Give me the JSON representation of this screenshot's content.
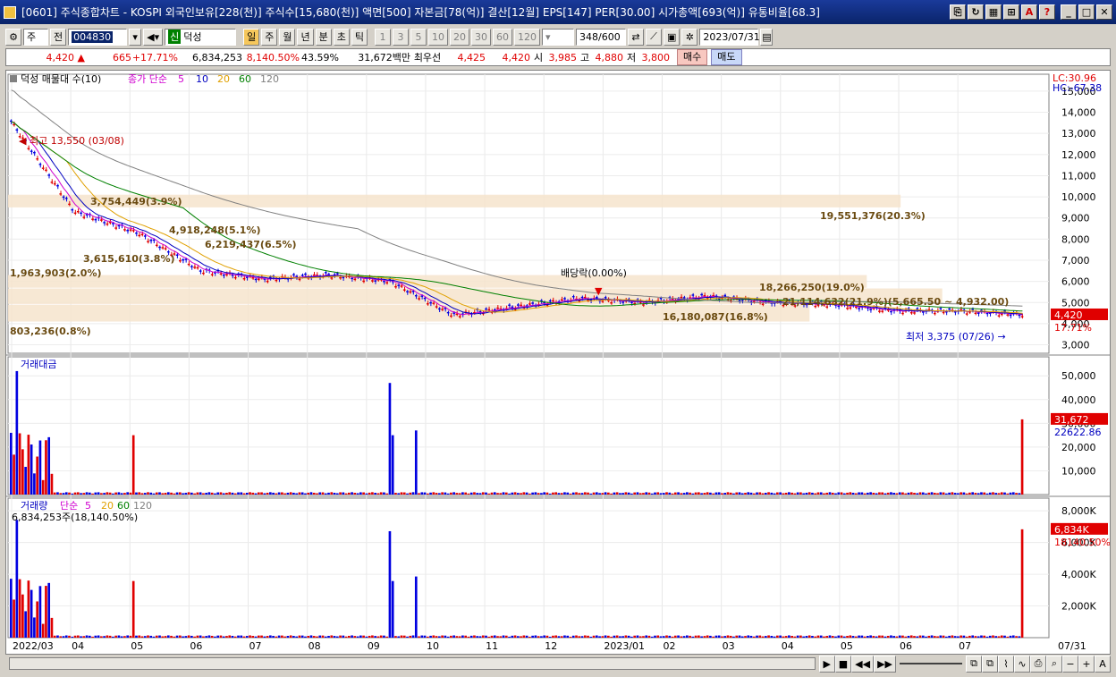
{
  "window": {
    "title": "[0601] 주식종합차트 - KOSPI 외국인보유[228(천)] 주식수[15,680(천)] 액면[500] 자본금[78(억)] 결산[12월] EPS[147] PER[30.00] 시가총액[693(억)] 유통비율[68.3]"
  },
  "toolbar": {
    "market": "주",
    "prev_label": "전",
    "code": "004830",
    "stock_name": "덕성",
    "period_buttons": [
      "일",
      "주",
      "월",
      "년",
      "분",
      "초",
      "틱"
    ],
    "interval_buttons": [
      "1",
      "3",
      "5",
      "10",
      "20",
      "30",
      "60",
      "120"
    ],
    "count": "348",
    "count_max": "/600",
    "date": "2023/07/31"
  },
  "quote": {
    "price": "4,420",
    "change": "665",
    "change_pct": "+17.71%",
    "volume": "6,834,253",
    "volume_ratio": "8,140.50%",
    "turnover": "43.59%",
    "amount": "31,672백만",
    "best_label": "최우선",
    "ask": "4,425",
    "bid": "4,420",
    "open_label": "시",
    "open": "3,985",
    "high_label": "고",
    "high": "4,880",
    "low_label": "저",
    "low": "3,800",
    "buy_label": "매수",
    "sell_label": "매도"
  },
  "price_panel": {
    "title": "덕성 매물대 수(10)",
    "ma_label": "종가 단순",
    "ma_periods": [
      "5",
      "10",
      "20",
      "60",
      "120"
    ],
    "ma_colors": [
      "#d000d0",
      "#0000c0",
      "#e0a000",
      "#008000",
      "#808080"
    ],
    "lc": "LC:30.96",
    "hc": "HC:-67.38",
    "last_price": "4,420",
    "last_pct": "17.71%",
    "high_marker": "최고 13,550 (03/08)",
    "low_marker": "최저 3,375 (07/26)",
    "dividend": "배당락(0.00%)",
    "profile_labels": [
      "3,754,449(3.9%)",
      "19,551,376(20.3%)",
      "4,918,248(5.1%)",
      "6,219,437(6.5%)",
      "3,615,610(3.8%)",
      "1,963,903(2.0%)",
      "18,266,250(19.0%)",
      "21,114,632(21.9%)(5,665.50 ~ 4,932.00)",
      "16,180,087(16.8%)",
      "803,236(0.8%)"
    ]
  },
  "amount_panel": {
    "title": "거래대금",
    "last_value": "31,672",
    "ma_value": "22622.86"
  },
  "volume_panel": {
    "title": "거래량",
    "ma_label": "단순",
    "ma_periods": [
      "5",
      "20",
      "60",
      "120"
    ],
    "summary": "6,834,253주(18,140.50%)",
    "last_value": "6,834K",
    "ma_value": "18140.50%"
  },
  "x_axis": [
    "2022/03",
    "04",
    "05",
    "06",
    "07",
    "08",
    "09",
    "10",
    "11",
    "12",
    "2023/01",
    "02",
    "03",
    "04",
    "05",
    "06",
    "07"
  ],
  "x_axis_right": "07/31",
  "chart_data": [
    {
      "type": "line",
      "title": "덕성 매물대 수(10)",
      "ylim": [
        2600,
        15800
      ],
      "y_ticks": [
        3000,
        4000,
        5000,
        6000,
        7000,
        8000,
        9000,
        10000,
        11000,
        12000,
        13000,
        14000,
        15000
      ],
      "x": [
        "2022/03",
        "04",
        "05",
        "06",
        "07",
        "08",
        "09",
        "10",
        "11",
        "12",
        "2023/01",
        "02",
        "03",
        "04",
        "05",
        "06",
        "07"
      ],
      "series": [
        {
          "values": [
            13550,
            9300,
            8300,
            6500,
            6100,
            6300,
            6000,
            4400,
            4800,
            5200,
            5000,
            5300,
            5000,
            4900,
            4600,
            4600,
            4420
          ]
        }
      ],
      "volume_profile": [
        {
          "range": [
            9500,
            10100
          ],
          "volume": "19,551,376",
          "pct": 20.3
        },
        {
          "range": [
            5700,
            6300
          ],
          "volume": "18,266,250",
          "pct": 19.0
        },
        {
          "range": [
            4932,
            5665.5
          ],
          "volume": "21,114,632",
          "pct": 21.9
        },
        {
          "range": [
            4100,
            4900
          ],
          "volume": "16,180,087",
          "pct": 16.8
        }
      ]
    },
    {
      "type": "bar",
      "title": "거래대금",
      "ylim": [
        0,
        58000
      ],
      "y_ticks": [
        10000,
        20000,
        30000,
        40000,
        50000
      ],
      "values_note": "daily traded amount",
      "last": 31672
    },
    {
      "type": "bar",
      "title": "거래량",
      "ylim": [
        0,
        8800
      ],
      "y_ticks": [
        "2,000K",
        "4,000K",
        "6,000K",
        "8,000K"
      ],
      "last": 6834
    }
  ]
}
